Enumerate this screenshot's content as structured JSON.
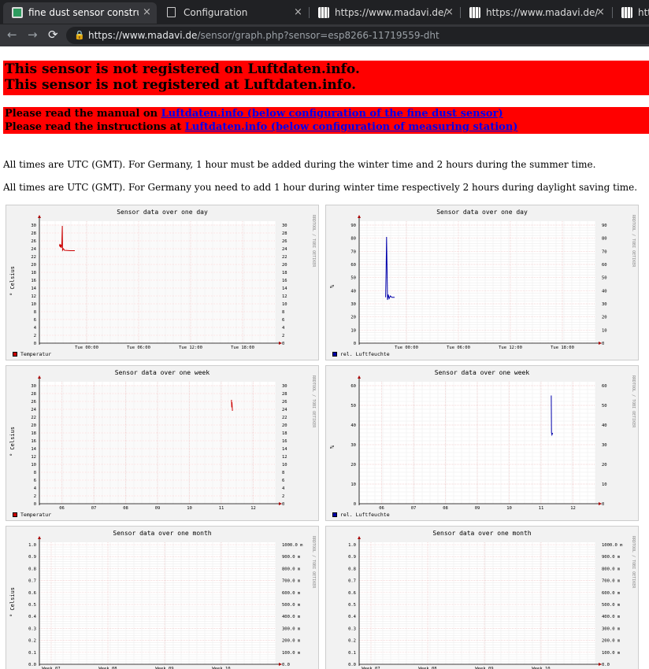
{
  "browser": {
    "tabs": [
      {
        "title": "fine dust sensor constructi",
        "active": true
      },
      {
        "title": "Configuration",
        "active": false
      },
      {
        "title": "https://www.madavi.de/se",
        "active": false
      },
      {
        "title": "https://www.madavi.de/se",
        "active": false
      },
      {
        "title": "http",
        "active": false
      }
    ],
    "close_glyph": "×",
    "nav": {
      "back": "←",
      "forward": "→",
      "reload": "⟳",
      "lock": "🔒"
    },
    "url_host": "https://www.madavi.de",
    "url_path": "/sensor/graph.php?sensor=esp8266-11719559-dht"
  },
  "page": {
    "not_registered": [
      "This sensor is not registered on Luftdaten.info.",
      "This sensor is not registered at Luftdaten.info."
    ],
    "manual_prefix": [
      "Please read the manual on ",
      "Please read the instructions at "
    ],
    "manual_link": [
      "Luftdaten.info (below configuration of the fine dust sensor)",
      "Luftdaten.info (below configuration of measuring station)"
    ],
    "utc_note": [
      "All times are UTC (GMT). For Germany, 1 hour must be added during the winter time and 2 hours during the summer time.",
      "All times are UTC (GMT). For Germany you need to add 1 hour during winter time respectively 2 hours during daylight saving time."
    ]
  },
  "graphs": [
    {
      "title": "Sensor data over one day",
      "ylabel": "° Celsius",
      "watermark": "RRDTOOL / TOBI OETIKER",
      "legend": "Temperatur",
      "color": "#cc0000",
      "yticks": [
        "0",
        "2",
        "4",
        "6",
        "8",
        "10",
        "12",
        "14",
        "16",
        "18",
        "20",
        "22",
        "24",
        "26",
        "28",
        "30"
      ],
      "ymax": 31,
      "yticks_right": [
        "0",
        "2",
        "4",
        "6",
        "8",
        "10",
        "12",
        "14",
        "16",
        "18",
        "20",
        "22",
        "24",
        "26",
        "28",
        "30"
      ],
      "xticks": [
        "Tue 00:00",
        "Tue 06:00",
        "Tue 12:00",
        "Tue 18:00"
      ],
      "xtick_pos": [
        0.2,
        0.42,
        0.64,
        0.86
      ],
      "line": [
        [
          0.085,
          24.6
        ],
        [
          0.087,
          25.2
        ],
        [
          0.089,
          24.4
        ],
        [
          0.091,
          25.0
        ],
        [
          0.093,
          24.2
        ],
        [
          0.095,
          25.2
        ],
        [
          0.097,
          29.8
        ],
        [
          0.098,
          23.6
        ],
        [
          0.102,
          24.0
        ],
        [
          0.106,
          23.6
        ],
        [
          0.13,
          23.5
        ],
        [
          0.15,
          23.5
        ]
      ]
    },
    {
      "title": "Sensor data over one day",
      "ylabel": "%",
      "watermark": "RRDTOOL / TOBI OETIKER",
      "legend": "rel. Luftfeuchte",
      "color": "#0000aa",
      "yticks": [
        "0",
        "10",
        "20",
        "30",
        "40",
        "50",
        "60",
        "70",
        "80",
        "90"
      ],
      "ymax": 93,
      "yticks_right": [
        "0",
        "10",
        "20",
        "30",
        "40",
        "50",
        "60",
        "70",
        "80",
        "90"
      ],
      "xticks": [
        "Tue 00:00",
        "Tue 06:00",
        "Tue 12:00",
        "Tue 18:00"
      ],
      "xtick_pos": [
        0.2,
        0.42,
        0.64,
        0.86
      ],
      "line": [
        [
          0.112,
          35
        ],
        [
          0.114,
          55
        ],
        [
          0.116,
          81
        ],
        [
          0.118,
          58
        ],
        [
          0.12,
          33
        ],
        [
          0.123,
          37
        ],
        [
          0.127,
          34
        ],
        [
          0.132,
          36
        ],
        [
          0.138,
          35
        ],
        [
          0.15,
          35
        ]
      ]
    },
    {
      "title": "Sensor data over one week",
      "ylabel": "° Celsius",
      "watermark": "RRDTOOL / TOBI OETIKER",
      "legend": "Temperatur",
      "color": "#cc0000",
      "yticks": [
        "0",
        "2",
        "4",
        "6",
        "8",
        "10",
        "12",
        "14",
        "16",
        "18",
        "20",
        "22",
        "24",
        "26",
        "28",
        "30"
      ],
      "ymax": 31,
      "yticks_right": [
        "0",
        "2",
        "4",
        "6",
        "8",
        "10",
        "12",
        "14",
        "16",
        "18",
        "20",
        "22",
        "24",
        "26",
        "28",
        "30"
      ],
      "xticks": [
        "06",
        "07",
        "08",
        "09",
        "10",
        "11",
        "12"
      ],
      "xtick_pos": [
        0.095,
        0.23,
        0.365,
        0.5,
        0.635,
        0.77,
        0.905
      ],
      "line": [
        [
          0.813,
          26.4
        ],
        [
          0.814,
          24.5
        ],
        [
          0.815,
          25.8
        ],
        [
          0.817,
          23.6
        ]
      ]
    },
    {
      "title": "Sensor data over one week",
      "ylabel": "%",
      "watermark": "RRDTOOL / TOBI OETIKER",
      "legend": "rel. Luftfeuchte",
      "color": "#0000aa",
      "yticks": [
        "0",
        "10",
        "20",
        "30",
        "40",
        "50",
        "60"
      ],
      "ymax": 62,
      "yticks_right": [
        "0",
        "10",
        "20",
        "30",
        "40",
        "50",
        "60"
      ],
      "xticks": [
        "06",
        "07",
        "08",
        "09",
        "10",
        "11",
        "12"
      ],
      "xtick_pos": [
        0.095,
        0.23,
        0.365,
        0.5,
        0.635,
        0.77,
        0.905
      ],
      "line": [
        [
          0.813,
          55
        ],
        [
          0.814,
          36
        ],
        [
          0.816,
          35
        ],
        [
          0.819,
          36
        ]
      ]
    },
    {
      "title": "Sensor data over one month",
      "ylabel": "° Celsius",
      "watermark": "RRDTOOL / TOBI OETIKER",
      "legend": "",
      "color": "#cc0000",
      "yticks": [
        "0.0",
        "0.1",
        "0.2",
        "0.3",
        "0.4",
        "0.5",
        "0.6",
        "0.7",
        "0.8",
        "0.9",
        "1.0"
      ],
      "ymax": 1.02,
      "yticks_right": [
        "0.0",
        "100.0 m",
        "200.0 m",
        "300.0 m",
        "400.0 m",
        "500.0 m",
        "600.0 m",
        "700.0 m",
        "800.0 m",
        "900.0 m",
        "1000.0 m"
      ],
      "xticks": [
        "Week 07",
        "Week 08",
        "Week 09",
        "Week 10"
      ],
      "xtick_pos": [
        0.05,
        0.29,
        0.53,
        0.77
      ],
      "line": []
    },
    {
      "title": "Sensor data over one month",
      "ylabel": "",
      "watermark": "RRDTOOL / TOBI OETIKER",
      "legend": "",
      "color": "#0000aa",
      "yticks": [
        "0.0",
        "0.1",
        "0.2",
        "0.3",
        "0.4",
        "0.5",
        "0.6",
        "0.7",
        "0.8",
        "0.9",
        "1.0"
      ],
      "ymax": 1.02,
      "yticks_right": [
        "0.0",
        "100.0 m",
        "200.0 m",
        "300.0 m",
        "400.0 m",
        "500.0 m",
        "600.0 m",
        "700.0 m",
        "800.0 m",
        "900.0 m",
        "1000.0 m"
      ],
      "xticks": [
        "Week 07",
        "Week 08",
        "Week 09",
        "Week 10"
      ],
      "xtick_pos": [
        0.05,
        0.29,
        0.53,
        0.77
      ],
      "line": []
    }
  ]
}
